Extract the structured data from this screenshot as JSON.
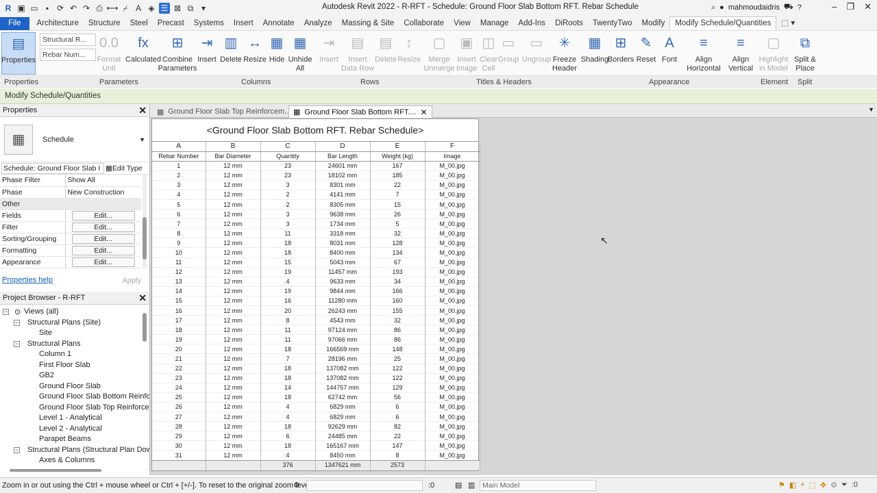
{
  "app": {
    "title": "Autodesk Revit 2022 - R-RFT - Schedule: Ground Floor Slab Bottom RFT. Rebar Schedule",
    "user": "mahmoudaidris"
  },
  "menu": [
    "File",
    "Architecture",
    "Structure",
    "Steel",
    "Precast",
    "Systems",
    "Insert",
    "Annotate",
    "Analyze",
    "Massing & Site",
    "Collaborate",
    "View",
    "Manage",
    "Add-Ins",
    "DiRoots",
    "TwentyTwo",
    "Modify",
    "Modify Schedule/Quantities"
  ],
  "ribbon": {
    "properties": "Properties",
    "param_select1": "Structural R...",
    "param_select2": "Rebar Num...",
    "buttons": [
      {
        "label": "Format Unit",
        "disabled": true,
        "icon": "0.0"
      },
      {
        "label": "Calculated",
        "disabled": false,
        "icon": "fx"
      },
      {
        "label": "Combine Parameters",
        "disabled": false,
        "icon": "⊞"
      },
      {
        "label": "Insert",
        "disabled": false,
        "icon": "⇥"
      },
      {
        "label": "Delete",
        "disabled": false,
        "icon": "▥"
      },
      {
        "label": "Resize",
        "disabled": false,
        "icon": "↔"
      },
      {
        "label": "Hide",
        "disabled": false,
        "icon": "▦"
      },
      {
        "label": "Unhide All",
        "disabled": false,
        "icon": "▦"
      },
      {
        "label": "Insert",
        "disabled": true,
        "icon": "⇥"
      },
      {
        "label": "Insert Data Row",
        "disabled": true,
        "icon": "▤"
      },
      {
        "label": "Delete",
        "disabled": true,
        "icon": "▤"
      },
      {
        "label": "Resize",
        "disabled": true,
        "icon": "↕"
      },
      {
        "label": "Merge Unmerge",
        "disabled": true,
        "icon": "▢"
      },
      {
        "label": "Insert Image",
        "disabled": true,
        "icon": "▣"
      },
      {
        "label": "Clear Cell",
        "disabled": true,
        "icon": "◫"
      },
      {
        "label": "Group",
        "disabled": true,
        "icon": "▭"
      },
      {
        "label": "Ungroup",
        "disabled": true,
        "icon": "▭"
      },
      {
        "label": "Freeze Header",
        "disabled": false,
        "icon": "✳"
      },
      {
        "label": "Shading",
        "disabled": false,
        "icon": "▦"
      },
      {
        "label": "Borders",
        "disabled": false,
        "icon": "⊞"
      },
      {
        "label": "Reset",
        "disabled": false,
        "icon": "✎"
      },
      {
        "label": "Font",
        "disabled": false,
        "icon": "A"
      },
      {
        "label": "Align Horizontal",
        "disabled": false,
        "icon": "≡"
      },
      {
        "label": "Align Vertical",
        "disabled": false,
        "icon": "≡"
      },
      {
        "label": "Highlight in Model",
        "disabled": true,
        "icon": "▢"
      },
      {
        "label": "Split & Place",
        "disabled": false,
        "icon": "⧉"
      }
    ],
    "panels": [
      "Properties",
      "Parameters",
      "Columns",
      "Rows",
      "Titles & Headers",
      "Appearance",
      "Element",
      "Split"
    ]
  },
  "context_bar": "Modify Schedule/Quantities",
  "properties_panel": {
    "title": "Properties",
    "type_name": "Schedule",
    "instance_selector": "Schedule: Ground Floor Slab I",
    "edit_type": "Edit Type",
    "rows": [
      {
        "label": "Phase Filter",
        "value": "Show All"
      },
      {
        "label": "Phase",
        "value": "New Construction"
      }
    ],
    "group_other": "Other",
    "edit_rows": [
      {
        "label": "Fields",
        "button": "Edit..."
      },
      {
        "label": "Filter",
        "button": "Edit..."
      },
      {
        "label": "Sorting/Grouping",
        "button": "Edit..."
      },
      {
        "label": "Formatting",
        "button": "Edit..."
      },
      {
        "label": "Appearance",
        "button": "Edit..."
      }
    ],
    "help_link": "Properties help",
    "apply": "Apply"
  },
  "project_browser": {
    "title": "Project Browser - R-RFT",
    "items": [
      {
        "label": "Views (all)",
        "level": 0,
        "toggle": "−"
      },
      {
        "label": "Structural Plans (Site)",
        "level": 1,
        "toggle": "−"
      },
      {
        "label": "Site",
        "level": 2,
        "toggle": ""
      },
      {
        "label": "Structural Plans",
        "level": 1,
        "toggle": "−"
      },
      {
        "label": "Column 1",
        "level": 2,
        "toggle": ""
      },
      {
        "label": "First Floor Slab",
        "level": 2,
        "toggle": ""
      },
      {
        "label": "GB2",
        "level": 2,
        "toggle": ""
      },
      {
        "label": "Ground Floor Slab",
        "level": 2,
        "toggle": ""
      },
      {
        "label": "Ground Floor Slab Bottom Reinfo",
        "level": 2,
        "toggle": ""
      },
      {
        "label": "Ground Floor Slab Top Reinforce",
        "level": 2,
        "toggle": ""
      },
      {
        "label": "Level 1 - Analytical",
        "level": 2,
        "toggle": ""
      },
      {
        "label": "Level 2 - Analytical",
        "level": 2,
        "toggle": ""
      },
      {
        "label": "Parapet Beams",
        "level": 2,
        "toggle": ""
      },
      {
        "label": "Structural Plans (Structural Plan Dow",
        "level": 1,
        "toggle": "−"
      },
      {
        "label": "Axes & Columns",
        "level": 2,
        "toggle": ""
      }
    ]
  },
  "view_tabs": [
    {
      "label": "Ground Floor Slab Top Reinforcem...",
      "active": false
    },
    {
      "label": "Ground Floor Slab Bottom RFT....",
      "active": true
    }
  ],
  "schedule": {
    "title": "<Ground Floor Slab Bottom RFT. Rebar Schedule>",
    "letters": [
      "A",
      "B",
      "C",
      "D",
      "E",
      "F"
    ],
    "headers": [
      "Rebar Number",
      "Bar Diameter",
      "Quantity",
      "Bar Length",
      "Weight (kg)",
      "Image"
    ],
    "rows": [
      [
        "1",
        "12 mm",
        "23",
        "24601 mm",
        "167",
        "M_00.jpg"
      ],
      [
        "2",
        "12 mm",
        "23",
        "18102 mm",
        "185",
        "M_00.jpg"
      ],
      [
        "3",
        "12 mm",
        "3",
        "8301 mm",
        "22",
        "M_00.jpg"
      ],
      [
        "4",
        "12 mm",
        "2",
        "4141 mm",
        "7",
        "M_00.jpg"
      ],
      [
        "5",
        "12 mm",
        "2",
        "8305 mm",
        "15",
        "M_00.jpg"
      ],
      [
        "6",
        "12 mm",
        "3",
        "9638 mm",
        "26",
        "M_00.jpg"
      ],
      [
        "7",
        "12 mm",
        "3",
        "1734 mm",
        "5",
        "M_00.jpg"
      ],
      [
        "8",
        "12 mm",
        "11",
        "3318 mm",
        "32",
        "M_00.jpg"
      ],
      [
        "9",
        "12 mm",
        "18",
        "8031 mm",
        "128",
        "M_00.jpg"
      ],
      [
        "10",
        "12 mm",
        "18",
        "8400 mm",
        "134",
        "M_00.jpg"
      ],
      [
        "11",
        "12 mm",
        "15",
        "5043 mm",
        "67",
        "M_00.jpg"
      ],
      [
        "12",
        "12 mm",
        "19",
        "11457 mm",
        "193",
        "M_00.jpg"
      ],
      [
        "13",
        "12 mm",
        "4",
        "9633 mm",
        "34",
        "M_00.jpg"
      ],
      [
        "14",
        "12 mm",
        "19",
        "9844 mm",
        "166",
        "M_00.jpg"
      ],
      [
        "15",
        "12 mm",
        "16",
        "11280 mm",
        "160",
        "M_00.jpg"
      ],
      [
        "16",
        "12 mm",
        "20",
        "26243 mm",
        "155",
        "M_00.jpg"
      ],
      [
        "17",
        "12 mm",
        "8",
        "4543 mm",
        "32",
        "M_00.jpg"
      ],
      [
        "18",
        "12 mm",
        "11",
        "97124 mm",
        "86",
        "M_00.jpg"
      ],
      [
        "19",
        "12 mm",
        "11",
        "97066 mm",
        "86",
        "M_00.jpg"
      ],
      [
        "20",
        "12 mm",
        "18",
        "166569 mm",
        "148",
        "M_00.jpg"
      ],
      [
        "21",
        "12 mm",
        "7",
        "28196 mm",
        "25",
        "M_00.jpg"
      ],
      [
        "22",
        "12 mm",
        "18",
        "137082 mm",
        "122",
        "M_00.jpg"
      ],
      [
        "23",
        "12 mm",
        "18",
        "137082 mm",
        "122",
        "M_00.jpg"
      ],
      [
        "24",
        "12 mm",
        "14",
        "144757 mm",
        "129",
        "M_00.jpg"
      ],
      [
        "25",
        "12 mm",
        "18",
        "62742 mm",
        "56",
        "M_00.jpg"
      ],
      [
        "26",
        "12 mm",
        "4",
        "6829 mm",
        "6",
        "M_00.jpg"
      ],
      [
        "27",
        "12 mm",
        "4",
        "6829 mm",
        "6",
        "M_00.jpg"
      ],
      [
        "28",
        "12 mm",
        "18",
        "92629 mm",
        "82",
        "M_00.jpg"
      ],
      [
        "29",
        "12 mm",
        "6",
        "24485 mm",
        "22",
        "M_00.jpg"
      ],
      [
        "30",
        "12 mm",
        "18",
        "165167 mm",
        "147",
        "M_00.jpg"
      ],
      [
        "31",
        "12 mm",
        "4",
        "8450 mm",
        "8",
        "M_00.jpg"
      ]
    ],
    "totals": [
      "",
      "",
      "376",
      "1347621 mm",
      "2573",
      ""
    ]
  },
  "status": {
    "message": "Zoom in or out using the Ctrl + mouse wheel or Ctrl + [+/-]. To reset to the original zoom level (",
    "count": ":0",
    "model": "Main Model",
    "filter_count": ":0"
  },
  "colors": {
    "accent": "#1e64c8",
    "context": "#e8f0d8",
    "canvas": "#d6d6d6"
  }
}
